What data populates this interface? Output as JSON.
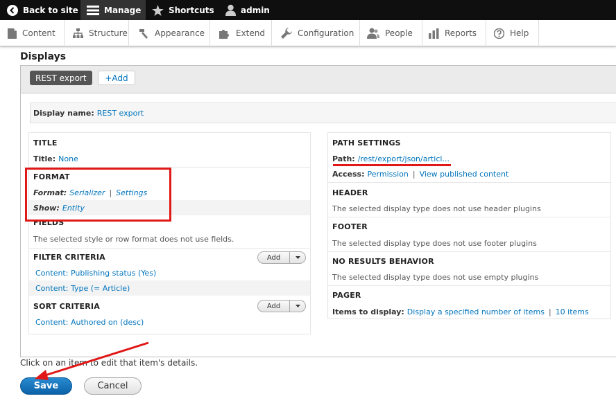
{
  "toolbar": {
    "back_label": "Back to site",
    "manage_label": "Manage",
    "shortcuts_label": "Shortcuts",
    "user_label": "admin"
  },
  "tray": {
    "items": [
      {
        "label": "Content",
        "icon": "file-icon"
      },
      {
        "label": "Structure",
        "icon": "sitemap-icon"
      },
      {
        "label": "Appearance",
        "icon": "paintbrush-icon"
      },
      {
        "label": "Extend",
        "icon": "puzzle-icon"
      },
      {
        "label": "Configuration",
        "icon": "wrench-icon"
      },
      {
        "label": "People",
        "icon": "people-icon"
      },
      {
        "label": "Reports",
        "icon": "bar-chart-icon"
      },
      {
        "label": "Help",
        "icon": "question-icon"
      }
    ]
  },
  "page": {
    "displays_title": "Displays",
    "tab_label": "REST export",
    "add_label": "+Add",
    "display_name_label": "Display name:",
    "display_name_value": "REST export"
  },
  "left": {
    "title_section": "TITLE",
    "title_label": "Title:",
    "title_value": "None",
    "format_section": "FORMAT",
    "format_label": "Format:",
    "format_value": "Serializer",
    "format_settings": "Settings",
    "show_label": "Show:",
    "show_value": "Entity",
    "fields_section": "FIELDS",
    "fields_text": "The selected style or row format does not use fields.",
    "filter_section": "FILTER CRITERIA",
    "filter_add": "Add",
    "filter_items": [
      "Content: Publishing status (Yes)",
      "Content: Type (= Article)"
    ],
    "sort_section": "SORT CRITERIA",
    "sort_add": "Add",
    "sort_items": [
      "Content: Authored on (desc)"
    ]
  },
  "right": {
    "path_section": "PATH SETTINGS",
    "path_label": "Path:",
    "path_value": "/rest/export/json/articl...",
    "access_label": "Access:",
    "access_value": "Permission",
    "access_perm": "View published content",
    "header_section": "HEADER",
    "header_text": "The selected display type does not use header plugins",
    "footer_section": "FOOTER",
    "footer_text": "The selected display type does not use footer plugins",
    "noresults_section": "NO RESULTS BEHAVIOR",
    "noresults_text": "The selected display type does not use empty plugins",
    "pager_section": "PAGER",
    "pager_label": "Items to display:",
    "pager_value": "Display a specified number of items",
    "pager_count": "10 items"
  },
  "footer": {
    "help_text": "Click on an item to edit that item's details.",
    "save_label": "Save",
    "cancel_label": "Cancel"
  },
  "colors": {
    "annotation": "#e01818",
    "link": "#0074bd",
    "primary_button": "#0b62a8"
  }
}
